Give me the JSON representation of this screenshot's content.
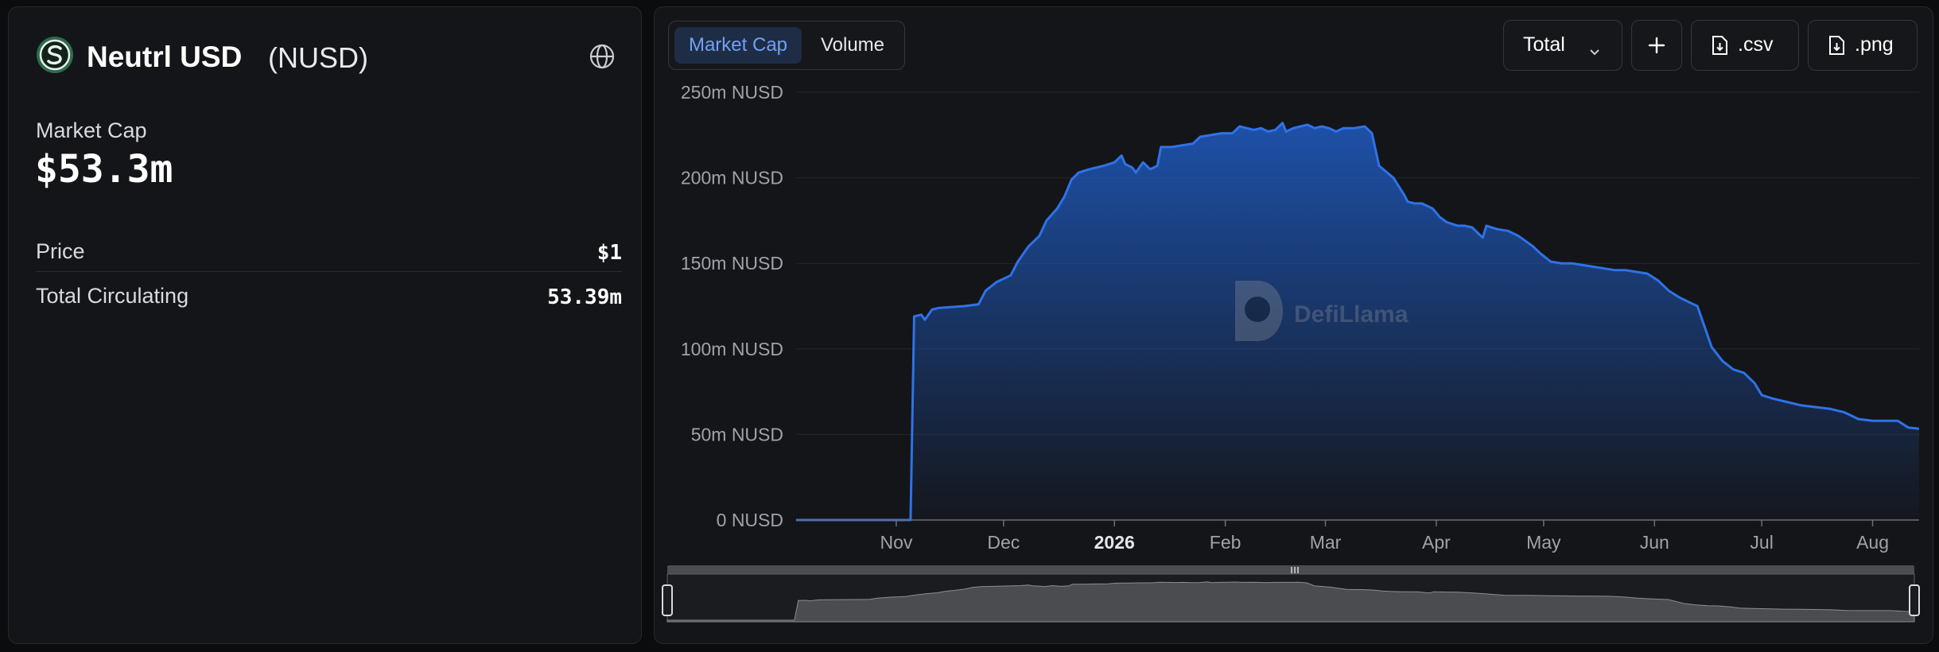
{
  "coin": {
    "name": "Neutrl USD",
    "symbol": "(NUSD)",
    "logo_icon": "neutrl-logo-icon",
    "link_icon": "globe-icon"
  },
  "summary": {
    "market_cap_label": "Market Cap",
    "market_cap_value": "$53.3m",
    "price_label": "Price",
    "price_value": "$1",
    "circulating_label": "Total Circulating",
    "circulating_value": "53.39m"
  },
  "toolbar": {
    "tabs": [
      {
        "label": "Market Cap",
        "active": true
      },
      {
        "label": "Volume",
        "active": false
      }
    ],
    "total_label": "Total",
    "total_icon": "chevron-down-icon",
    "add_icon": "plus-icon",
    "csv_label": ".csv",
    "png_label": ".png",
    "file_icon": "file-download-icon"
  },
  "watermark": "DefiLlama",
  "colors": {
    "accent": "#2f72e8",
    "background": "#141518",
    "active_tab_bg": "#1f2c45",
    "active_tab_text": "#6fa1f1"
  },
  "chart_data": {
    "type": "area",
    "ylim": [
      0,
      250
    ],
    "yunit": "m NUSD",
    "y_ticks": [
      "250m NUSD",
      "200m NUSD",
      "150m NUSD",
      "100m NUSD",
      "50m NUSD",
      "0 NUSD"
    ],
    "x_ticks": [
      {
        "label": "Nov",
        "date": "2025-11-01",
        "bold": false
      },
      {
        "label": "Dec",
        "date": "2025-12-01",
        "bold": false
      },
      {
        "label": "2026",
        "date": "2026-01-01",
        "bold": true
      },
      {
        "label": "Feb",
        "date": "2026-02-01",
        "bold": false
      },
      {
        "label": "Mar",
        "date": "2026-03-01",
        "bold": false
      },
      {
        "label": "Apr",
        "date": "2026-04-01",
        "bold": false
      },
      {
        "label": "May",
        "date": "2026-05-01",
        "bold": false
      },
      {
        "label": "Jun",
        "date": "2026-06-01",
        "bold": false
      },
      {
        "label": "Jul",
        "date": "2026-07-01",
        "bold": false
      },
      {
        "label": "Aug",
        "date": "2026-08-01",
        "bold": false
      }
    ],
    "grid": true,
    "series": [
      {
        "points": [
          [
            "2025-10-04",
            0
          ],
          [
            "2025-11-05",
            0
          ],
          [
            "2025-11-06",
            119
          ],
          [
            "2025-11-08",
            120
          ],
          [
            "2025-11-09",
            117
          ],
          [
            "2025-11-11",
            123
          ],
          [
            "2025-11-13",
            124
          ],
          [
            "2025-11-20",
            125
          ],
          [
            "2025-11-24",
            126
          ],
          [
            "2025-11-26",
            134
          ],
          [
            "2025-11-29",
            139
          ],
          [
            "2025-12-03",
            143
          ],
          [
            "2025-12-05",
            151
          ],
          [
            "2025-12-08",
            160
          ],
          [
            "2025-12-11",
            166
          ],
          [
            "2025-12-13",
            175
          ],
          [
            "2025-12-16",
            182
          ],
          [
            "2025-12-18",
            189
          ],
          [
            "2025-12-20",
            199
          ],
          [
            "2025-12-22",
            203
          ],
          [
            "2025-12-25",
            205
          ],
          [
            "2025-12-29",
            207
          ],
          [
            "2026-01-01",
            209
          ],
          [
            "2026-01-02",
            211
          ],
          [
            "2026-01-03",
            213
          ],
          [
            "2026-01-04",
            208
          ],
          [
            "2026-01-06",
            206
          ],
          [
            "2026-01-07",
            203
          ],
          [
            "2026-01-09",
            209
          ],
          [
            "2026-01-11",
            205
          ],
          [
            "2026-01-13",
            207
          ],
          [
            "2026-01-14",
            218
          ],
          [
            "2026-01-17",
            218
          ],
          [
            "2026-01-20",
            219
          ],
          [
            "2026-01-23",
            220
          ],
          [
            "2026-01-25",
            224
          ],
          [
            "2026-01-28",
            225
          ],
          [
            "2026-01-31",
            226
          ],
          [
            "2026-02-03",
            226
          ],
          [
            "2026-02-05",
            230
          ],
          [
            "2026-02-07",
            229
          ],
          [
            "2026-02-09",
            228
          ],
          [
            "2026-02-11",
            229
          ],
          [
            "2026-02-13",
            227
          ],
          [
            "2026-02-15",
            228
          ],
          [
            "2026-02-17",
            232
          ],
          [
            "2026-02-18",
            227
          ],
          [
            "2026-02-20",
            229
          ],
          [
            "2026-02-22",
            230
          ],
          [
            "2026-02-24",
            231
          ],
          [
            "2026-02-26",
            229
          ],
          [
            "2026-02-28",
            230
          ],
          [
            "2026-03-02",
            229
          ],
          [
            "2026-03-04",
            227
          ],
          [
            "2026-03-06",
            229
          ],
          [
            "2026-03-09",
            229
          ],
          [
            "2026-03-12",
            230
          ],
          [
            "2026-03-14",
            226
          ],
          [
            "2026-03-16",
            207
          ],
          [
            "2026-03-20",
            200
          ],
          [
            "2026-03-23",
            190
          ],
          [
            "2026-03-24",
            186
          ],
          [
            "2026-03-26",
            185
          ],
          [
            "2026-03-28",
            185
          ],
          [
            "2026-03-31",
            182
          ],
          [
            "2026-04-02",
            177
          ],
          [
            "2026-04-04",
            174
          ],
          [
            "2026-04-07",
            172
          ],
          [
            "2026-04-09",
            172
          ],
          [
            "2026-04-11",
            171
          ],
          [
            "2026-04-14",
            165
          ],
          [
            "2026-04-15",
            172
          ],
          [
            "2026-04-18",
            170
          ],
          [
            "2026-04-21",
            169
          ],
          [
            "2026-04-24",
            166
          ],
          [
            "2026-04-28",
            160
          ],
          [
            "2026-04-30",
            156
          ],
          [
            "2026-05-03",
            151
          ],
          [
            "2026-05-06",
            150
          ],
          [
            "2026-05-09",
            150
          ],
          [
            "2026-05-12",
            149
          ],
          [
            "2026-05-15",
            148
          ],
          [
            "2026-05-18",
            147
          ],
          [
            "2026-05-21",
            146
          ],
          [
            "2026-05-24",
            146
          ],
          [
            "2026-05-27",
            145
          ],
          [
            "2026-05-30",
            144
          ],
          [
            "2026-06-02",
            140
          ],
          [
            "2026-06-05",
            134
          ],
          [
            "2026-06-08",
            130
          ],
          [
            "2026-06-11",
            127
          ],
          [
            "2026-06-13",
            125
          ],
          [
            "2026-06-15",
            113
          ],
          [
            "2026-06-17",
            101
          ],
          [
            "2026-06-20",
            93
          ],
          [
            "2026-06-23",
            88
          ],
          [
            "2026-06-26",
            86
          ],
          [
            "2026-06-29",
            80
          ],
          [
            "2026-07-01",
            73
          ],
          [
            "2026-07-04",
            71
          ],
          [
            "2026-07-08",
            69
          ],
          [
            "2026-07-12",
            67
          ],
          [
            "2026-07-16",
            66
          ],
          [
            "2026-07-20",
            65
          ],
          [
            "2026-07-24",
            63
          ],
          [
            "2026-07-28",
            59
          ],
          [
            "2026-08-01",
            58
          ],
          [
            "2026-08-04",
            58
          ],
          [
            "2026-08-08",
            58
          ],
          [
            "2026-08-11",
            54
          ],
          [
            "2026-08-14",
            53.3
          ]
        ]
      }
    ],
    "x_range": [
      "2025-10-04",
      "2026-08-14"
    ],
    "brush": {
      "start": 0,
      "end": 1
    }
  }
}
